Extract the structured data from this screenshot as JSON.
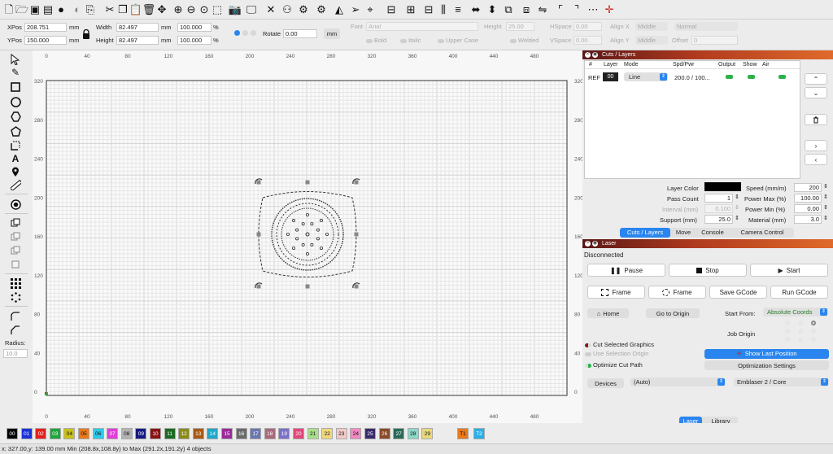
{
  "toolbar_icons": [
    "new-file",
    "open-folder",
    "save",
    "save-as",
    "circle-filled",
    "circle-gray",
    "copy",
    "cut",
    "copy-2",
    "paste",
    "delete",
    "move",
    "zoom-in",
    "zoom-out",
    "zoom-fit",
    "select-rect",
    "camera",
    "monitor",
    "tools",
    "users",
    "align",
    "settings",
    "triangle",
    "send",
    "target",
    "align-left",
    "align-center",
    "align-right",
    "dist-h",
    "dist-v",
    "size-h",
    "size-v",
    "group",
    "ungroup",
    "flip",
    "corner-tl",
    "corner-tr",
    "dots",
    "crosshair"
  ],
  "props": {
    "xpos_label": "XPos",
    "xpos_value": "208.751",
    "ypos_label": "YPos",
    "ypos_value": "150.000",
    "unit_mm": "mm",
    "width_label": "Width",
    "width_value": "82.497",
    "height_label": "Height",
    "height_value": "82.497",
    "scale_w": "100.000",
    "scale_h": "100.000",
    "pct": "%",
    "rotate_label": "Rotate",
    "rotate_value": "0.00",
    "rotate_unit": "mm",
    "font_label": "Font",
    "font_value": "Arial",
    "height2_label": "Height",
    "height2_value": "25.00",
    "hspace_label": "HSpace",
    "hspace_value": "0.00",
    "alignx_label": "Align X",
    "alignx_value": "Middle",
    "normal_value": "Normal",
    "bold": "Bold",
    "italic": "Italic",
    "uppercase": "Upper Case",
    "welded": "Welded",
    "vspace_label": "VSpace",
    "vspace_value": "0.00",
    "aligny_label": "Align Y",
    "aligny_value": "Middle",
    "offset_label": "Offset",
    "offset_value": "0"
  },
  "left_tools": {
    "radius_label": "Radius:",
    "radius_value": "10.0"
  },
  "ruler": {
    "x_ticks": [
      "0",
      "40",
      "80",
      "120",
      "160",
      "200",
      "240",
      "280",
      "320",
      "360",
      "400",
      "440",
      "480"
    ],
    "y_ticks": [
      "320",
      "280",
      "240",
      "200",
      "160",
      "120",
      "80",
      "40",
      "0"
    ]
  },
  "cuts": {
    "title": "Cuts / Layers",
    "headers": [
      "#",
      "Layer",
      "Mode",
      "Spd/Pwr",
      "Output",
      "Show",
      "Air"
    ],
    "row": {
      "num": "REF",
      "layer": "00",
      "mode": "Line",
      "spd": "200.0 / 100..."
    },
    "layer_color_label": "Layer Color",
    "layer_color": "#000000",
    "pass_label": "Pass Count",
    "pass_value": "1",
    "interval_label": "Interval (mm)",
    "interval_value": "0.100",
    "support_label": "Support (mm)",
    "support_value": "25.0",
    "speed_label": "Speed (mm/m)",
    "speed_value": "200",
    "pmax_label": "Power Max (%)",
    "pmax_value": "100.00",
    "pmin_label": "Power Min (%)",
    "pmin_value": "0.00",
    "material_label": "Material (mm)",
    "material_value": "3.0",
    "tabs": [
      "Cuts / Layers",
      "Move",
      "Console",
      "Camera Control"
    ]
  },
  "laser": {
    "title": "Laser",
    "status": "Disconnected",
    "pause": "Pause",
    "stop": "Stop",
    "start": "Start",
    "frame1": "Frame",
    "frame2": "Frame",
    "save_gcode": "Save GCode",
    "run_gcode": "Run GCode",
    "home": "Home",
    "go_origin": "Go to Origin",
    "start_from_label": "Start From:",
    "start_from_value": "Absolute Coords",
    "job_origin_label": "Job Origin",
    "cut_selected": "Cut Selected Graphics",
    "use_selection_origin": "Use Selection Origin",
    "optimize_cut": "Optimize Cut Path",
    "show_last": "Show Last Position",
    "opt_settings": "Optimization Settings",
    "devices_label": "Devices",
    "devices_value": "(Auto)",
    "device_name": "Emblaser 2 / Core",
    "bottom_tabs": [
      "Laser",
      "Library"
    ]
  },
  "palette": [
    {
      "l": "00",
      "c": "#000000",
      "t": "#fff"
    },
    {
      "l": "01",
      "c": "#1a32d8",
      "t": "#fff"
    },
    {
      "l": "02",
      "c": "#e3201b",
      "t": "#fff"
    },
    {
      "l": "03",
      "c": "#1fa53a",
      "t": "#fff"
    },
    {
      "l": "04",
      "c": "#c9c01e",
      "t": "#111"
    },
    {
      "l": "05",
      "c": "#e87a1c",
      "t": "#111"
    },
    {
      "l": "06",
      "c": "#2ec8e8",
      "t": "#111"
    },
    {
      "l": "07",
      "c": "#e03fd8",
      "t": "#fff"
    },
    {
      "l": "08",
      "c": "#b3b3b3",
      "t": "#111"
    },
    {
      "l": "09",
      "c": "#151a80",
      "t": "#fff"
    },
    {
      "l": "10",
      "c": "#8a1212",
      "t": "#fff"
    },
    {
      "l": "11",
      "c": "#1a6a22",
      "t": "#fff"
    },
    {
      "l": "12",
      "c": "#8a8a18",
      "t": "#fff"
    },
    {
      "l": "13",
      "c": "#a85a14",
      "t": "#fff"
    },
    {
      "l": "14",
      "c": "#22a6c8",
      "t": "#fff"
    },
    {
      "l": "15",
      "c": "#9a2a98",
      "t": "#fff"
    },
    {
      "l": "16",
      "c": "#6a6a6a",
      "t": "#fff"
    },
    {
      "l": "17",
      "c": "#6a78b0",
      "t": "#fff"
    },
    {
      "l": "18",
      "c": "#a86a7a",
      "t": "#fff"
    },
    {
      "l": "19",
      "c": "#7a72c8",
      "t": "#fff"
    },
    {
      "l": "20",
      "c": "#e0487a",
      "t": "#fff"
    },
    {
      "l": "21",
      "c": "#a8e08a",
      "t": "#111"
    },
    {
      "l": "22",
      "c": "#f0d87a",
      "t": "#111"
    },
    {
      "l": "23",
      "c": "#f2c8c8",
      "t": "#111"
    },
    {
      "l": "24",
      "c": "#f08ac0",
      "t": "#111"
    },
    {
      "l": "25",
      "c": "#3a2a6a",
      "t": "#fff"
    },
    {
      "l": "26",
      "c": "#8a4a28",
      "t": "#fff"
    },
    {
      "l": "27",
      "c": "#2a6a58",
      "t": "#fff"
    },
    {
      "l": "28",
      "c": "#8ad8c8",
      "t": "#111"
    },
    {
      "l": "29",
      "c": "#e8d87a",
      "t": "#111"
    },
    {
      "l": "T1",
      "c": "#e87a1c",
      "t": "#111"
    },
    {
      "l": "T2",
      "c": "#2ab0e8",
      "t": "#fff"
    }
  ],
  "status": "x: 327.00,y: 139.00 mm    Min (208.8x,108.8y) to Max (291.2x,191.2y)  4 objects"
}
